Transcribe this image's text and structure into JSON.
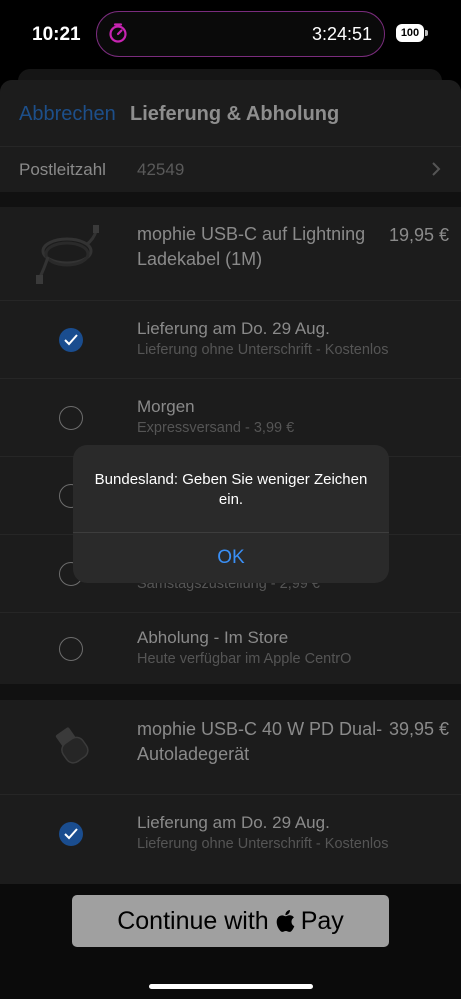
{
  "status_bar": {
    "time": "10:21",
    "timer": "3:24:51",
    "battery": "100"
  },
  "nav": {
    "cancel": "Abbrechen",
    "title": "Lieferung & Abholung"
  },
  "postal": {
    "label": "Postleitzahl",
    "value": "42549"
  },
  "products": [
    {
      "name": "mophie USB-C auf Lightning Ladekabel (1M)",
      "price": "19,95 €",
      "options": [
        {
          "title": "Lieferung am Do. 29 Aug.",
          "subtitle": "Lieferung ohne Unterschrift - Kostenlos",
          "selected": true
        },
        {
          "title": "Morgen",
          "subtitle": "Expressversand - 3,99 €",
          "selected": false
        },
        {
          "title": "",
          "subtitle": "",
          "selected": false
        },
        {
          "title": "",
          "subtitle": "Samstagszustellung - 2,99 €",
          "selected": false
        },
        {
          "title": "Abholung - Im Store",
          "subtitle": "Heute verfügbar im Apple CentrO",
          "selected": false
        }
      ]
    },
    {
      "name": "mophie USB-C 40 W PD Dual-Autoladegerät",
      "price": "39,95 €",
      "options": [
        {
          "title": "Lieferung am Do. 29 Aug.",
          "subtitle": "Lieferung ohne Unterschrift - Kostenlos",
          "selected": true
        }
      ]
    }
  ],
  "pay_button": {
    "label_prefix": "Continue with",
    "label_suffix": "Pay"
  },
  "alert": {
    "message": "Bundesland: Geben Sie weniger Zeichen ein.",
    "ok": "OK"
  },
  "colors": {
    "accent": "#3a8ff5",
    "radio_selected": "#1a4d8f",
    "timer": "#c724b1"
  }
}
